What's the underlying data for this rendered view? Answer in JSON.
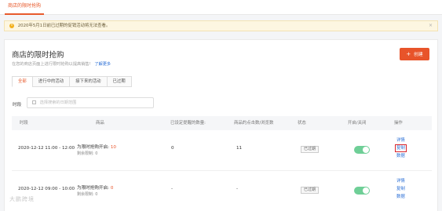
{
  "top_tab": "商店的限时抢购",
  "notice": {
    "icon": "info-icon",
    "text": "2020年5月1日前已过期的促销活动将无法查看。",
    "close": "×"
  },
  "header": {
    "title": "商店的限时抢购",
    "subtitle": "在您的商店页面上进行限时抢购以提高销售!",
    "learn_more": "了解更多",
    "create_label": "创建",
    "create_icon": "+"
  },
  "tabs": [
    "全部",
    "进行中的活动",
    "接下来的活动",
    "已过期"
  ],
  "filter": {
    "label": "时段",
    "placeholder": "选择搜索的日期范围"
  },
  "columns": [
    "时段",
    "商品",
    "已设定提醒的数量:",
    "商品的点击数/浏览数",
    "状态",
    "开启/关闭",
    "操作"
  ],
  "rows": [
    {
      "period": "2020-12-12 11:00 - 12:00",
      "product_enabled_label": "为限时抢购开启:",
      "product_enabled_count": "10",
      "product_stock_label": "剩余限制:",
      "product_stock_count": "0",
      "reminders": "0",
      "clicks": "11",
      "status": "已过期",
      "toggle_on": true,
      "actions": [
        "详情",
        "复制",
        "数据"
      ]
    },
    {
      "period": "2020-12-12 09:00 - 10:00",
      "product_enabled_label": "为限时抢购开启:",
      "product_enabled_count": "0",
      "product_stock_label": "剩余限制:",
      "product_stock_count": "0",
      "reminders": "-",
      "clicks": "-",
      "status": "已过期",
      "toggle_on": true,
      "actions": [
        "详情",
        "复制",
        "数据"
      ]
    }
  ],
  "watermark": "大鹏跨境"
}
